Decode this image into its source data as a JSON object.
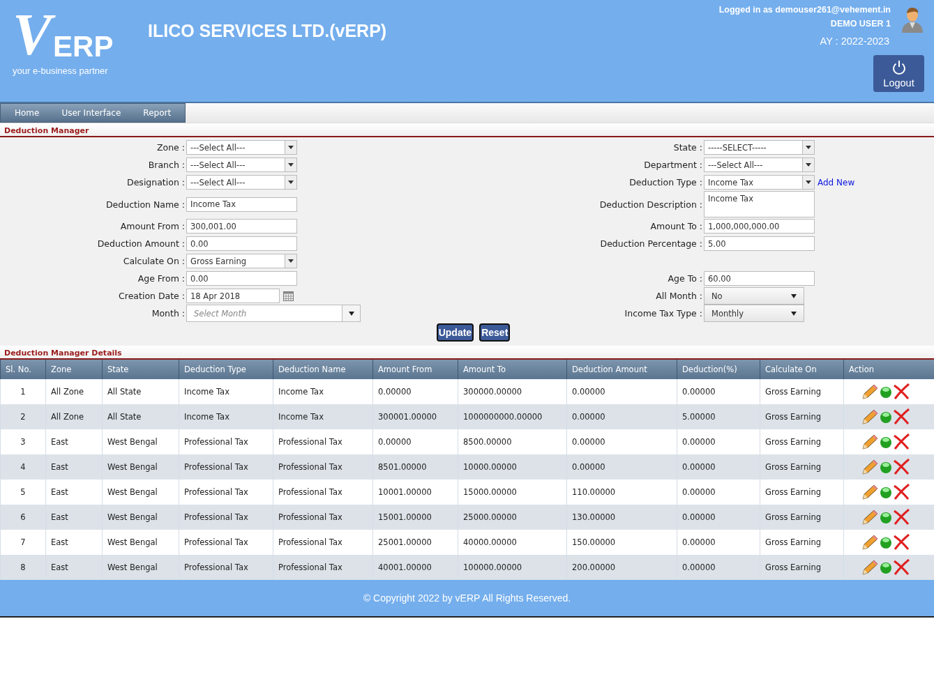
{
  "header": {
    "logo": {
      "mark": "V",
      "name": "ERP",
      "tagline": "your e-business partner"
    },
    "company": "ILICO SERVICES LTD.(vERP)",
    "logged_in": "Logged in as demouser261@vehement.in",
    "user": "DEMO USER 1",
    "year": "AY : 2022-2023",
    "logout": "Logout"
  },
  "menu": [
    {
      "label": "Home"
    },
    {
      "label": "User Interface"
    },
    {
      "label": "Report"
    }
  ],
  "form_title": "Deduction Manager",
  "form_rows": [
    {
      "left": {
        "label": "Zone :",
        "kind": "select",
        "value": "---Select All---"
      },
      "right": {
        "label": "State :",
        "kind": "select",
        "value": "-----SELECT-----"
      }
    },
    {
      "left": {
        "label": "Branch :",
        "kind": "select",
        "value": "---Select All---"
      },
      "right": {
        "label": "Department :",
        "kind": "select",
        "value": "---Select All---"
      }
    },
    {
      "left": {
        "label": "Designation :",
        "kind": "select",
        "value": "---Select All---"
      },
      "right": {
        "label": "Deduction Type :",
        "kind": "select",
        "value": "Income Tax",
        "link": "Add New"
      }
    },
    {
      "left": {
        "label": "Deduction Name :",
        "kind": "text",
        "value": "Income Tax"
      },
      "right": {
        "label": "Deduction Description :",
        "kind": "textarea",
        "value": "Income Tax"
      }
    },
    {
      "left": {
        "label": "Amount From :",
        "kind": "text",
        "value": "300,001.00"
      },
      "right": {
        "label": "Amount To :",
        "kind": "text",
        "value": "1,000,000,000.00"
      }
    },
    {
      "left": {
        "label": "Deduction Amount :",
        "kind": "text",
        "value": "0.00"
      },
      "right": {
        "label": "Deduction Percentage :",
        "kind": "text",
        "value": "5.00"
      }
    },
    {
      "left": {
        "label": "Calculate On :",
        "kind": "select",
        "value": "Gross Earning"
      }
    },
    {
      "left": {
        "label": "Age From :",
        "kind": "text",
        "value": "0.00"
      },
      "right": {
        "label": "Age To :",
        "kind": "text",
        "value": "60.00"
      }
    },
    {
      "left": {
        "label": "Creation Date :",
        "kind": "date",
        "value": "18 Apr 2018"
      },
      "right": {
        "label": "All Month :",
        "kind": "dropdown",
        "value": "No"
      }
    },
    {
      "left": {
        "label": "Month :",
        "kind": "combo",
        "placeholder": "Select Month"
      },
      "right": {
        "label": "Income Tax Type :",
        "kind": "dropdown",
        "value": "Monthly"
      }
    }
  ],
  "buttons": [
    "Update",
    "Reset"
  ],
  "details_title": "Deduction Manager Details",
  "table": {
    "columns": [
      "Sl. No.",
      "Zone",
      "State",
      "Deduction Type",
      "Deduction Name",
      "Amount From",
      "Amount To",
      "Deduction Amount",
      "Deduction(%)",
      "Calculate On",
      "Action"
    ],
    "rows": [
      [
        "1",
        "All Zone",
        "All State",
        "Income Tax",
        "Income Tax",
        "0.00000",
        "300000.00000",
        "0.00000",
        "0.00000",
        "Gross Earning"
      ],
      [
        "2",
        "All Zone",
        "All State",
        "Income Tax",
        "Income Tax",
        "300001.00000",
        "1000000000.00000",
        "0.00000",
        "5.00000",
        "Gross Earning"
      ],
      [
        "3",
        "East",
        "West Bengal",
        "Professional Tax",
        "Professional Tax",
        "0.00000",
        "8500.00000",
        "0.00000",
        "0.00000",
        "Gross Earning"
      ],
      [
        "4",
        "East",
        "West Bengal",
        "Professional Tax",
        "Professional Tax",
        "8501.00000",
        "10000.00000",
        "0.00000",
        "0.00000",
        "Gross Earning"
      ],
      [
        "5",
        "East",
        "West Bengal",
        "Professional Tax",
        "Professional Tax",
        "10001.00000",
        "15000.00000",
        "110.00000",
        "0.00000",
        "Gross Earning"
      ],
      [
        "6",
        "East",
        "West Bengal",
        "Professional Tax",
        "Professional Tax",
        "15001.00000",
        "25000.00000",
        "130.00000",
        "0.00000",
        "Gross Earning"
      ],
      [
        "7",
        "East",
        "West Bengal",
        "Professional Tax",
        "Professional Tax",
        "25001.00000",
        "40000.00000",
        "150.00000",
        "0.00000",
        "Gross Earning"
      ],
      [
        "8",
        "East",
        "West Bengal",
        "Professional Tax",
        "Professional Tax",
        "40001.00000",
        "100000.00000",
        "200.00000",
        "0.00000",
        "Gross Earning"
      ]
    ]
  },
  "footer": "© Copyright 2022 by vERP All Rights Reserved."
}
